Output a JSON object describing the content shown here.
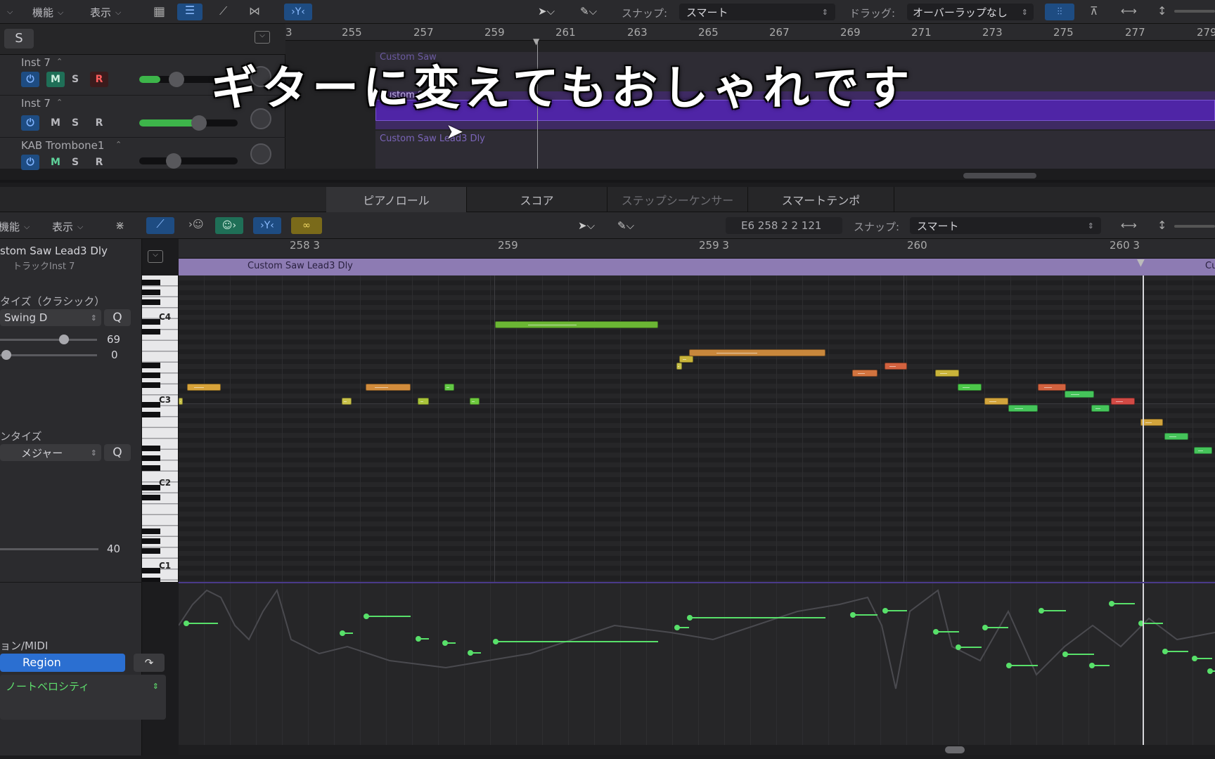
{
  "subtitle": "ギターに変えてもおしゃれです",
  "top_toolbar": {
    "func_menu": "機能",
    "view_menu": "表示",
    "snap_label": "スナップ:",
    "snap_value": "スマート",
    "drag_label": "ドラッグ:",
    "drag_value": "オーバーラップなし"
  },
  "track_header": {
    "solo_button": "S"
  },
  "ruler_top": [
    "3",
    "255",
    "257",
    "259",
    "261",
    "263",
    "265",
    "267",
    "269",
    "271",
    "273",
    "275",
    "277",
    "279"
  ],
  "tracks": [
    {
      "name": "Inst 7",
      "mute": "M",
      "solo": "S",
      "rec": "R",
      "region": "Custom Saw"
    },
    {
      "name": "Inst 7",
      "mute": "M",
      "solo": "S",
      "rec": "R",
      "region": "Custom Saw"
    },
    {
      "name": "KAB Trombone1",
      "mute": "M",
      "solo": "S",
      "rec": "R",
      "region": "Custom Saw Lead3 Dly"
    }
  ],
  "editor_tabs": [
    "ピアノロール",
    "スコア",
    "ステップシーケンサー",
    "スマートテンポ"
  ],
  "editor_toolbar": {
    "func_menu": "機能",
    "view_menu": "表示",
    "position": "E6   258 2 2 121",
    "snap_label": "スナップ:",
    "snap_value": "スマート"
  },
  "inspector": {
    "region_name": "stom Saw Lead3 Dly",
    "track_name": "トラックInst 7",
    "quantize_title": "タイズ（クラシック）",
    "quantize_value": "Swing D",
    "q_button": "Q",
    "strength_value": "69",
    "swing_value": "0",
    "scale_title": "ンタイズ",
    "scale_value": "メジャー",
    "scale_q": "Q",
    "velocity_value": "40",
    "automation_title": "ョン/MIDI",
    "region_button": "Region",
    "lane_value": "ノートベロシティ"
  },
  "editor_ruler": [
    "258 3",
    "259",
    "259 3",
    "260",
    "260 3"
  ],
  "editor_region_name": "Custom Saw Lead3 Dly",
  "editor_region_name_right": "Cu",
  "piano_labels": [
    "C4",
    "C3",
    "C2",
    "C1"
  ],
  "colors": {
    "accent_blue": "#2b6fd1",
    "region_purple": "#6b3fb0",
    "velocity_green": "#58e06a"
  }
}
